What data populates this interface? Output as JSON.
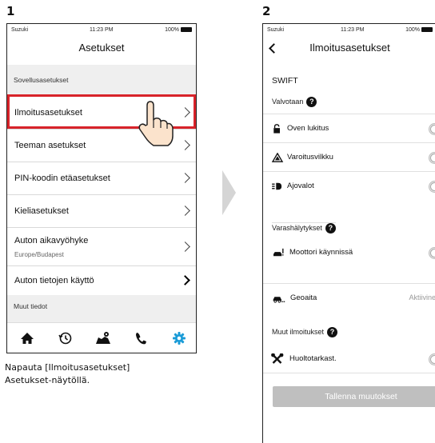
{
  "steps": {
    "one": "1",
    "two": "2"
  },
  "status_bar": {
    "carrier": "Suzuki",
    "time": "11:23 PM",
    "battery": "100%"
  },
  "screen1": {
    "title": "Asetukset",
    "section_app": "Sovellusasetukset",
    "items": [
      {
        "label": "Ilmoitusasetukset"
      },
      {
        "label": "Teeman asetukset"
      },
      {
        "label": "PIN-koodin etäasetukset"
      },
      {
        "label": "Kieliasetukset"
      },
      {
        "label": "Auton aikavyöhyke",
        "sub": "Europe/Budapest"
      },
      {
        "label": "Auton tietojen käyttö"
      }
    ],
    "section_more": "Muut tiedot",
    "tabs": [
      "home-icon",
      "history-icon",
      "map-icon",
      "phone-icon",
      "settings-icon"
    ],
    "accent_color": "#1a9bd7",
    "highlight_color": "#d8232a"
  },
  "caption": {
    "line1": "Napauta [Ilmoitusasetukset]",
    "line2": "Asetukset-näytöllä."
  },
  "screen2": {
    "title": "Ilmoitusasetukset",
    "brand": "SWIFT",
    "section_monitored": "Valvotaan",
    "monitored_items": [
      {
        "label": "Oven lukitus",
        "icon": "lock-icon",
        "enabled": false
      },
      {
        "label": "Varoitusvilkku",
        "icon": "hazard-icon",
        "enabled": false
      },
      {
        "label": "Ajovalot",
        "icon": "headlight-icon",
        "enabled": false
      }
    ],
    "section_theft": "Varashälytykset",
    "theft_items": [
      {
        "label": "Moottori käynnissä",
        "icon": "engine-running-icon",
        "enabled": false
      }
    ],
    "geofence": {
      "label": "Geoaita",
      "icon": "car-geofence-icon",
      "status": "Aktiivinen"
    },
    "section_other": "Muut ilmoitukset",
    "other_items": [
      {
        "label": "Huoltotarkast.",
        "icon": "wrench-icon",
        "enabled": false
      }
    ],
    "save_label": "Tallenna muutokset",
    "help_glyph": "?"
  }
}
